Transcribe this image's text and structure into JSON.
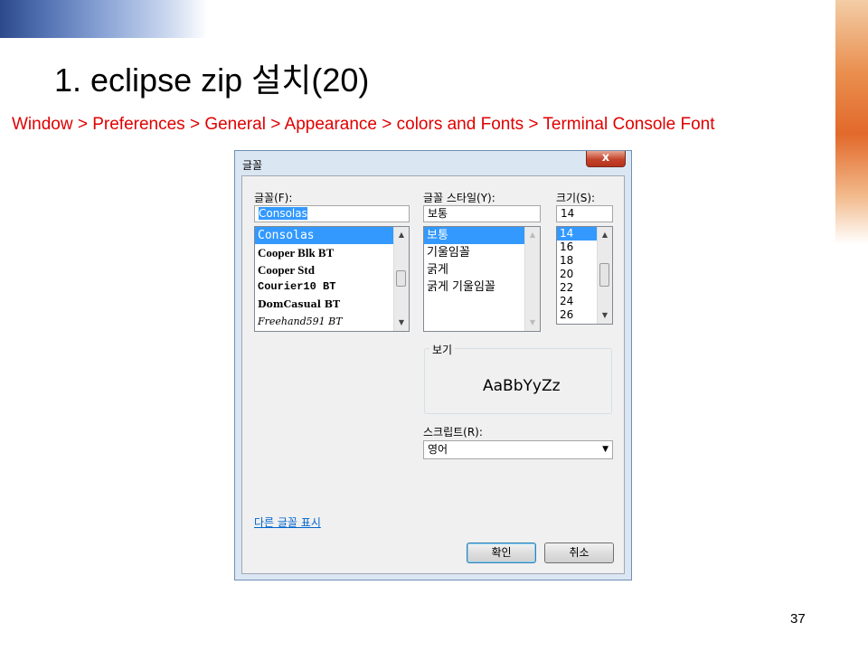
{
  "slide": {
    "title": "1. eclipse zip 설치(20)",
    "path": "Window > Preferences > General > Appearance  > colors and Fonts > Terminal Console Font",
    "page_number": "37"
  },
  "dialog": {
    "title": "글꼴",
    "close_label": "x",
    "font": {
      "label": "글꼴(F):",
      "value": "Consolas",
      "items": [
        "Consolas",
        "Cooper Blk BT",
        "Cooper Std",
        "Courier10 BT",
        "DomCasual BT",
        "Freehand591 BT"
      ],
      "selected_index": 0
    },
    "style": {
      "label": "글꼴 스타일(Y):",
      "value": "보통",
      "items": [
        "보통",
        "기울임꼴",
        "굵게",
        "굵게 기울임꼴"
      ],
      "selected_index": 0
    },
    "size": {
      "label": "크기(S):",
      "value": "14",
      "items": [
        "14",
        "16",
        "18",
        "20",
        "22",
        "24",
        "26"
      ],
      "selected_index": 0
    },
    "preview": {
      "label": "보기",
      "sample": "AaBbYyZz"
    },
    "script": {
      "label": "스크립트(R):",
      "value": "영어"
    },
    "more_fonts_link": "다른 글꼴 표시",
    "ok_label": "확인",
    "cancel_label": "취소"
  }
}
